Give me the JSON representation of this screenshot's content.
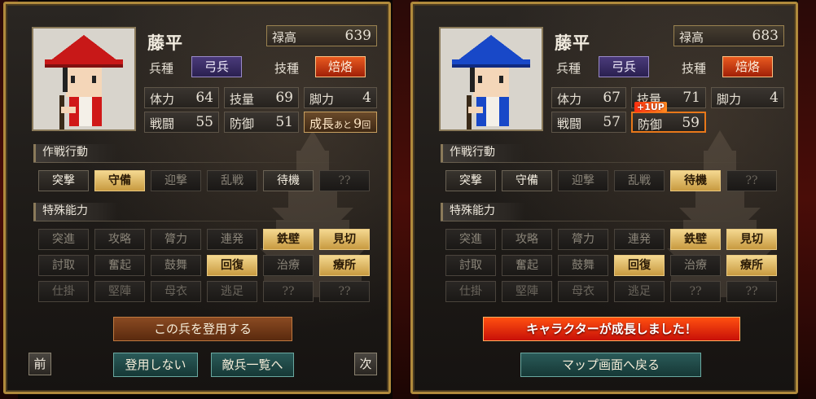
{
  "left": {
    "name": "藤平",
    "salary_label": "禄高",
    "salary_value": "639",
    "troop_label": "兵種",
    "troop_value": "弓兵",
    "skill_label": "技種",
    "skill_value": "焙烙",
    "stats": {
      "hp_label": "体力",
      "hp": "64",
      "tech_label": "技量",
      "tech": "69",
      "leg_label": "脚力",
      "leg": "4",
      "atk_label": "戦闘",
      "atk": "55",
      "def_label": "防御",
      "def": "51",
      "growth_label": "成長",
      "growth_mid": "あと",
      "growth_num": "9",
      "growth_unit": "回"
    },
    "tactics_title": "作戦行動",
    "tactics": [
      "突撃",
      "守備",
      "迎撃",
      "乱戦",
      "待機",
      "??"
    ],
    "abilities_title": "特殊能力",
    "abilities": [
      "突進",
      "攻略",
      "膂力",
      "連発",
      "鉄壁",
      "見切",
      "討取",
      "奮起",
      "鼓舞",
      "回復",
      "治療",
      "療所",
      "仕掛",
      "堅陣",
      "母衣",
      "逃足",
      "??",
      "??"
    ],
    "recruit_button": "この兵を登用する",
    "prev_button": "前",
    "no_recruit_button": "登用しない",
    "enemy_list_button": "敵兵一覧へ",
    "next_button": "次",
    "hat_color": "#c81818",
    "clothes_color": "#d01818"
  },
  "right": {
    "name": "藤平",
    "salary_label": "禄高",
    "salary_value": "683",
    "troop_label": "兵種",
    "troop_value": "弓兵",
    "skill_label": "技種",
    "skill_value": "焙烙",
    "stats": {
      "hp_label": "体力",
      "hp": "67",
      "tech_label": "技量",
      "tech": "71",
      "leg_label": "脚力",
      "leg": "4",
      "atk_label": "戦闘",
      "atk": "57",
      "def_label": "防御",
      "def": "59",
      "up_tag": "+1UP"
    },
    "tactics_title": "作戦行動",
    "tactics": [
      "突撃",
      "守備",
      "迎撃",
      "乱戦",
      "待機",
      "??"
    ],
    "abilities_title": "特殊能力",
    "abilities": [
      "突進",
      "攻略",
      "膂力",
      "連発",
      "鉄壁",
      "見切",
      "討取",
      "奮起",
      "鼓舞",
      "回復",
      "治療",
      "療所",
      "仕掛",
      "堅陣",
      "母衣",
      "逃足",
      "??",
      "??"
    ],
    "grown_message": "キャラクターが成長しました！",
    "map_button": "マップ画面へ戻る",
    "hat_color": "#1848c8",
    "clothes_color": "#1848c8"
  }
}
